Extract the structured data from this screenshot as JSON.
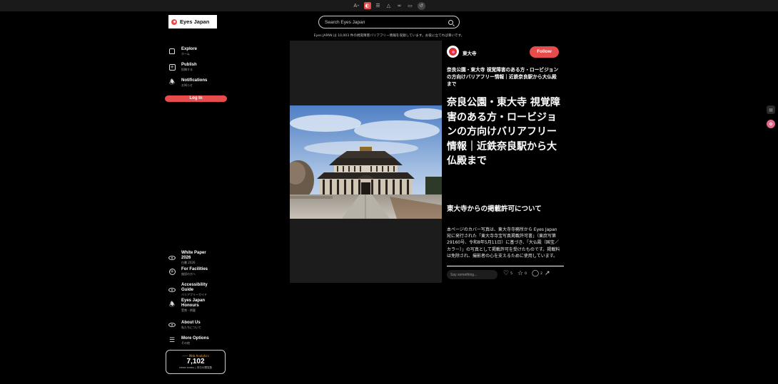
{
  "toolbar": {
    "items": [
      {
        "icon": "text-size-icon",
        "glyph": "A⚕"
      },
      {
        "icon": "contrast-icon",
        "glyph": "◐"
      },
      {
        "icon": "list-icon",
        "glyph": "☰"
      },
      {
        "icon": "chart-icon",
        "glyph": "⩔"
      },
      {
        "icon": "link-icon",
        "glyph": "⚇"
      },
      {
        "icon": "screen-icon",
        "glyph": "▭"
      },
      {
        "icon": "reset-icon",
        "glyph": "↺"
      }
    ]
  },
  "brand": {
    "name": "Eyes Japan",
    "accent": "#e74c4c"
  },
  "search": {
    "placeholder": "Search Eyes Japan"
  },
  "tagline": "Eyes JAPAN は 10,003 件の視覚障害バリアフリー情報を収録しています。お役に立てれば幸いです。",
  "nav_top": [
    {
      "label": "Explore",
      "sub": "ホーム",
      "icon": "home-icon"
    },
    {
      "label": "Publish",
      "sub": "投稿する",
      "icon": "publish-icon"
    },
    {
      "label": "Notifications",
      "sub": "お知らせ",
      "icon": "bell-icon"
    }
  ],
  "login_label": "Log In",
  "nav_bottom": [
    {
      "label": "White Paper 2026",
      "sub": "白書 2026",
      "icon": "eye-icon"
    },
    {
      "label": "For Facilities",
      "sub": "施設の方へ",
      "icon": "plus-circle-icon"
    },
    {
      "label": "Accessibility Guide",
      "sub": "バリアフリーガイド",
      "icon": "eye-icon"
    },
    {
      "label": "Eyes Japan Honours",
      "sub": "受賞・掲載",
      "icon": "bell-icon"
    },
    {
      "label": "About Us",
      "sub": "私たちについて",
      "icon": "eye-icon"
    },
    {
      "label": "More Options",
      "sub": "その他",
      "icon": "menu-icon"
    }
  ],
  "analytics": {
    "title": "Web Analytics",
    "count": "7,102",
    "sub": "views today | 本日の閲覧数"
  },
  "post": {
    "author": "東大寺",
    "follow_label": "Follow",
    "title_small": "奈良公園・東大寺 視覚障害のある方・ロービジョンの方向けバリアフリー情報｜近鉄奈良駅から大仏殿まで",
    "title_large": "奈良公園・東大寺 視覚障害のある方・ロービジョンの方向けバリアフリー情報｜近鉄奈良駅から大仏殿まで",
    "section_heading": "東大寺からの掲載許可について",
    "body": "本ページのカバー写真は、東大寺寺務所から Eyes Japan 宛に発行された「東大寺寺宝写真掲載許可書」（東庶写第29160号、令和8年5月11日）に基づき、「大仏殿（国宝／カラー）」の写真として掲載許可を受けたものです。掲載料は免除され、撮影者の心を支えるために使用しています。",
    "comment_placeholder": "Say something...",
    "likes": "5",
    "stars": "0",
    "comments": "2"
  }
}
